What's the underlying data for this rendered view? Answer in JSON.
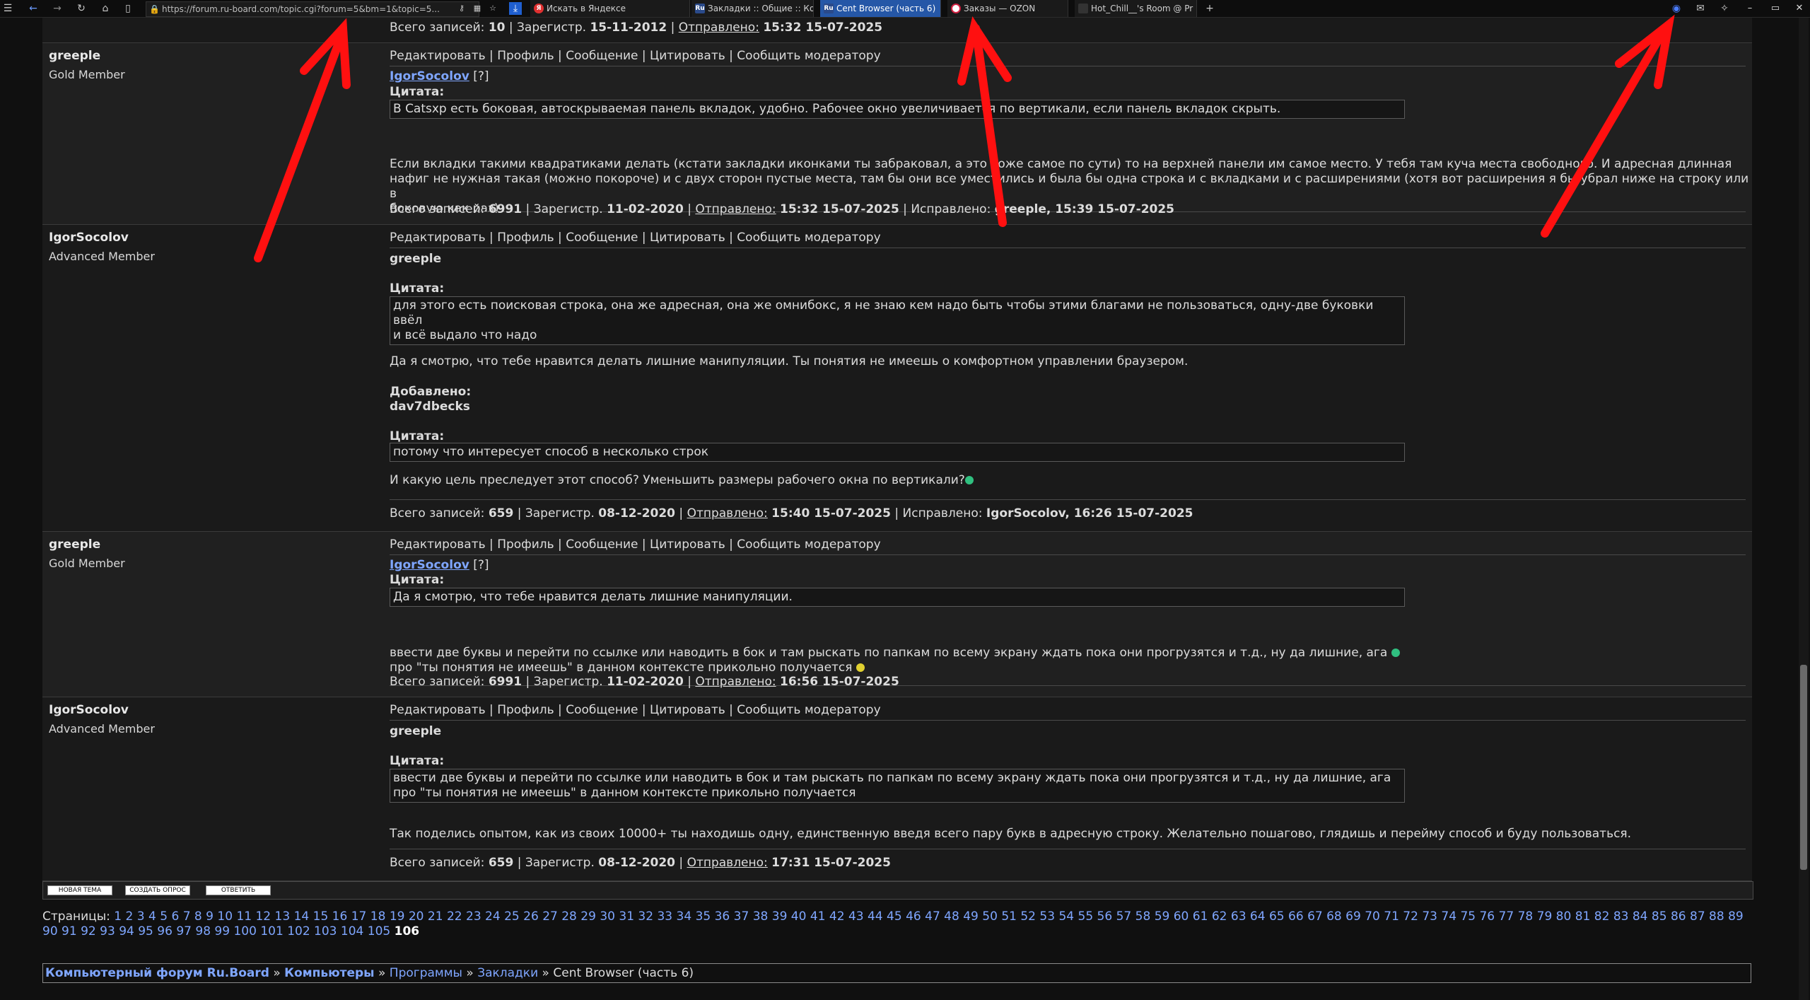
{
  "browser": {
    "url": "https://forum.ru-board.com/topic.cgi?forum=5&bm=1&topic=5...",
    "tabs": [
      {
        "title": "Искать в Яндексе",
        "active": false
      },
      {
        "title": "Закладки :: Общие :: Ко",
        "active": false
      },
      {
        "title": "Cent Browser (часть 6)",
        "active": true
      },
      {
        "title": "Заказы — OZON",
        "active": false
      },
      {
        "title": "Hot_Chill__'s Room @ Pr",
        "active": false
      }
    ],
    "new_tab": "+"
  },
  "top_meta": {
    "records_label": "Всего записей:",
    "records": "10",
    "reg_label": "Зарегистр.",
    "reg": "15-11-2012",
    "sent_label": "Отправлено:",
    "sent": "15:32 15-07-2025"
  },
  "actions": {
    "edit": "Редактировать",
    "profile": "Профиль",
    "message": "Сообщение",
    "quote": "Цитировать",
    "report": "Сообщить модератору"
  },
  "posts": [
    {
      "user": "greeple",
      "rank": "Gold Member",
      "to_user": "IgorSocolov",
      "to_suffix": "[?]",
      "quote_label": "Цитата:",
      "quote": "В Catsxp есть боковая, автоскрываемая панель вкладок, удобно. Рабочее окно увеличивается по вертикали, если панель вкладок скрыть.",
      "body": [
        "Если вкладки такими квадратиками делать (кстати закладки иконками ты забраковал, а это тоже самое по сути) то на верхней панели им самое место. У тебя там куча места свободного. И адресная длинная",
        "нафиг не нужная такая (можно покороче) и с двух сторон пустые места, там бы они все уместились и была бы одна строка и с вкладками и с расширениями (хотя вот расширения я бы убрал ниже на строку или в",
        "боковую как раз)"
      ],
      "meta": {
        "records": "6991",
        "reg": "11-02-2020",
        "sent": "15:32 15-07-2025",
        "edited_label": "Исправлено:",
        "edited": "greeple, 15:39 15-07-2025"
      }
    },
    {
      "user": "IgorSocolov",
      "rank": "Advanced Member",
      "addr": "greeple",
      "quote_label": "Цитата:",
      "quote": "для этого есть поисковая строка, она же адресная, она же омнибокс, я не знаю кем надо быть чтобы этими благами не пользоваться, одну-две буковки ввёл",
      "quote2": "и всё выдало что надо",
      "body1": "Да я смотрю, что тебе нравится делать лишние манипуляции. Ты понятия не имеешь о комфортном управлении браузером.",
      "added_label": "Добавлено:",
      "added_user": "dav7dbecks",
      "quote_b": "потому что интересует способ в несколько строк",
      "body2": "И какую цель преследует этот способ? Уменьшить размеры рабочего окна по вертикали?",
      "meta": {
        "records": "659",
        "reg": "08-12-2020",
        "sent": "15:40 15-07-2025",
        "edited_label": "Исправлено:",
        "edited": "IgorSocolov, 16:26 15-07-2025"
      }
    },
    {
      "user": "greeple",
      "rank": "Gold Member",
      "to_user": "IgorSocolov",
      "to_suffix": "[?]",
      "quote_label": "Цитата:",
      "quote": "Да я смотрю, что тебе нравится делать лишние манипуляции.",
      "body": [
        "ввести две буквы и перейти по ссылке или наводить в бок и там рыскать по папкам по всему экрану ждать пока они прогрузятся и т.д., ну да лишние, ага",
        "про \"ты понятия не имеешь\" в данном контексте прикольно получается"
      ],
      "meta": {
        "records": "6991",
        "reg": "11-02-2020",
        "sent": "16:56 15-07-2025"
      }
    },
    {
      "user": "IgorSocolov",
      "rank": "Advanced Member",
      "addr": "greeple",
      "quote_label": "Цитата:",
      "quote": "ввести две буквы и перейти по ссылке или наводить в бок и там рыскать по папкам по всему экрану ждать пока они прогрузятся и т.д., ну да лишние, ага",
      "quote2": "про \"ты понятия не имеешь\" в данном контексте прикольно получается",
      "body1": "Так поделись опытом, как из своих 10000+ ты находишь одну, единственную введя всего пару букв в адресную строку. Желательно пошагово, глядишь и перейму способ и буду пользоваться.",
      "meta": {
        "records": "659",
        "reg": "08-12-2020",
        "sent": "17:31 15-07-2025"
      }
    }
  ],
  "buttons": {
    "new_topic": "НОВАЯ ТЕМА",
    "new_poll": "СОЗДАТЬ ОПРОС",
    "reply": "ОТВЕТИТЬ"
  },
  "pagination": {
    "label": "Страницы:",
    "total": 106,
    "current": "106"
  },
  "breadcrumb": {
    "forum": "Компьютерный форум Ru.Board",
    "section": "Компьютеры",
    "sub": "Программы",
    "sub2": "Закладки",
    "topic": "Cent Browser (часть 6)"
  },
  "colors": {
    "link": "#7fa6ff",
    "arrow": "#ff1010",
    "active_tab": "#2557a7"
  }
}
